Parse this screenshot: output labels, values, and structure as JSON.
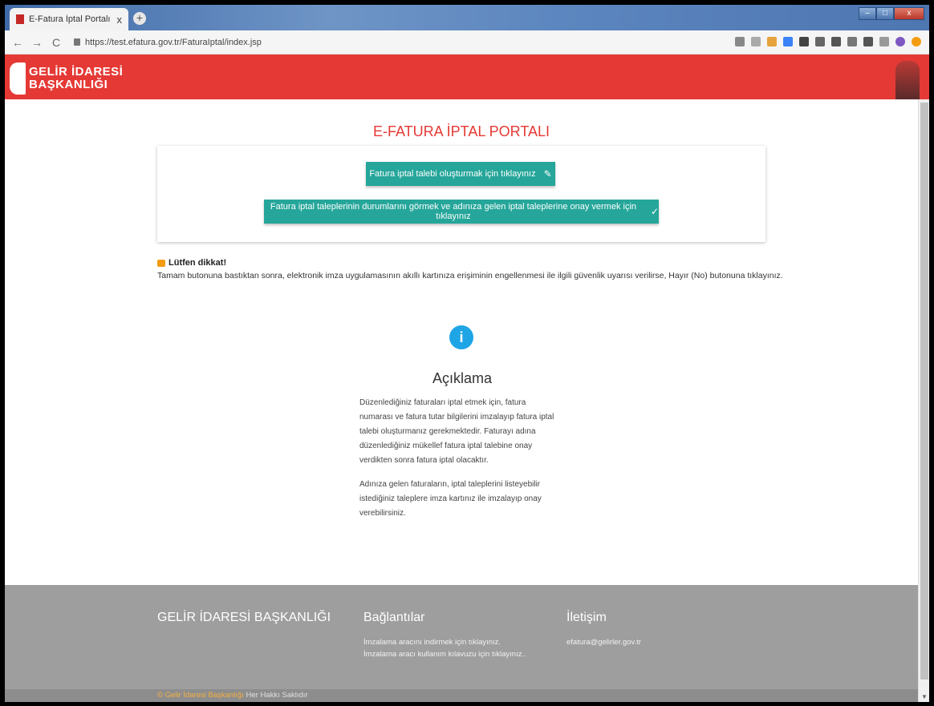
{
  "browser": {
    "tab_title": "E-Fatura İptal Portalı",
    "tab_close": "x",
    "new_tab": "+",
    "url": "https://test.efatura.gov.tr/FaturaIptal/index.jsp",
    "win_min": "‒",
    "win_max": "□",
    "win_close": "x"
  },
  "header": {
    "logo_line1": "GELİR İDARESİ",
    "logo_line2": "BAŞKANLIĞI"
  },
  "main": {
    "portal_title": "E-FATURA İPTAL PORTALI",
    "btn_create": "Fatura iptal talebi oluşturmak için tıklayınız",
    "btn_status": "Fatura iptal taleplerinin durumlarını görmek ve adınıza gelen iptal taleplerine onay vermek için tıklayınız",
    "notice_title": "Lütfen dikkat!",
    "notice_text": "Tamam butonuna bastıktan sonra, elektronik imza uygulamasının akıllı kartınıza erişiminin engellenmesi ile ilgili güvenlik uyarısı verilirse, Hayır (No) butonuna tıklayınız.",
    "info_glyph": "i",
    "desc_title": "Açıklama",
    "desc_p1": "Düzenlediğiniz faturaları iptal etmek için, fatura numarası ve fatura tutar bilgilerini imzalayıp fatura iptal talebi oluşturmanız gerekmektedir. Faturayı adına düzenlediğiniz mükellef fatura iptal talebine onay verdikten sonra fatura iptal olacaktır.",
    "desc_p2": "Adınıza gelen faturaların, iptal taleplerini listeyebilir istediğiniz taleplere imza kartınız ile imzalayıp onay verebilirsiniz."
  },
  "footer": {
    "org_title": "GELİR İDARESİ BAŞKANLIĞI",
    "links_title": "Bağlantılar",
    "link1": "İmzalama aracını indirmek için tıklayınız.",
    "link2": "İmzalama aracı kullanım kılavuzu için tıklayınız..",
    "contact_title": "İletişim",
    "email": "efatura@gelirler.gov.tr",
    "copy_brand": "© Gelir İdaresi Başkanlığı",
    "copy_rest": "Her Hakkı Saklıdır"
  },
  "colors": {
    "header_red": "#e53935",
    "button_teal": "#26a69a",
    "info_blue": "#1ea5e6",
    "footer_gray": "#9e9e9e"
  }
}
